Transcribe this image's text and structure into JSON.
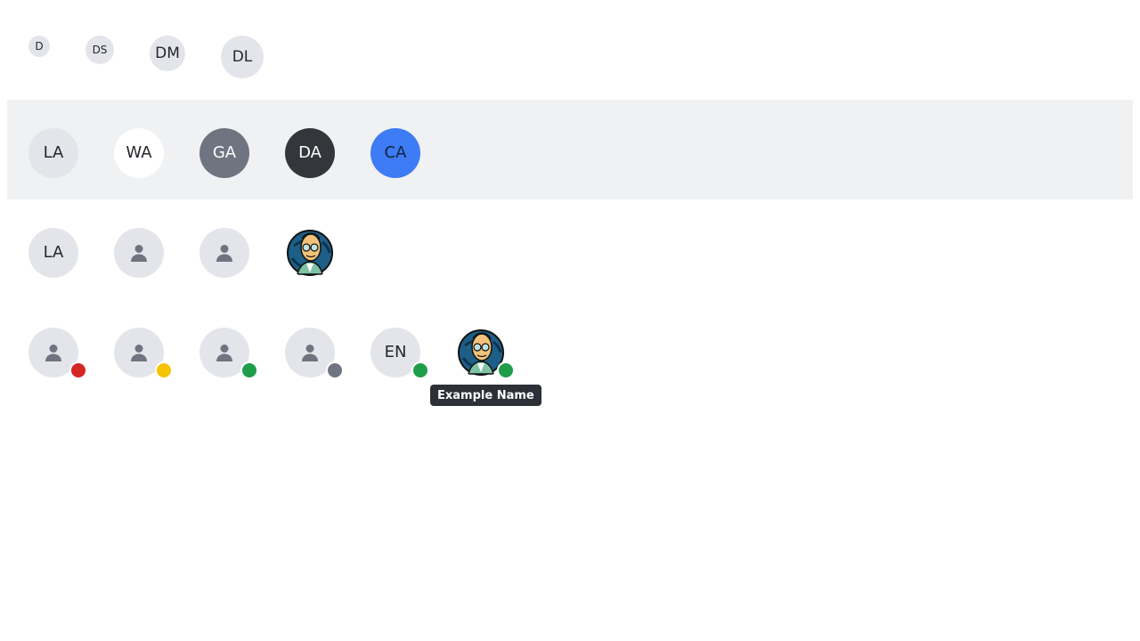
{
  "sizes_row": {
    "avatars": [
      {
        "initials": "D"
      },
      {
        "initials": "DS"
      },
      {
        "initials": "DM"
      },
      {
        "initials": "DL"
      }
    ]
  },
  "colors_row": {
    "avatars": [
      {
        "initials": "LA",
        "variant": "light",
        "bg": "#e4e5ea",
        "fg": "#24272c"
      },
      {
        "initials": "WA",
        "variant": "white",
        "bg": "#ffffff",
        "fg": "#24272c"
      },
      {
        "initials": "GA",
        "variant": "gray",
        "bg": "#6f7480",
        "fg": "#ffffff"
      },
      {
        "initials": "DA",
        "variant": "dark",
        "bg": "#33363b",
        "fg": "#ffffff"
      },
      {
        "initials": "CA",
        "variant": "color",
        "bg": "#3e7cf6",
        "fg": "#12233f"
      }
    ]
  },
  "types_row": {
    "avatars": [
      {
        "type": "initials",
        "initials": "LA"
      },
      {
        "type": "icon",
        "icon": "person-icon"
      },
      {
        "type": "icon",
        "icon": "person-icon"
      },
      {
        "type": "image",
        "icon": "profile-photo"
      }
    ]
  },
  "status_row": {
    "avatars": [
      {
        "type": "icon",
        "icon": "person-icon",
        "status": "busy",
        "status_color": "#d42424"
      },
      {
        "type": "icon",
        "icon": "person-icon",
        "status": "away",
        "status_color": "#f5c400"
      },
      {
        "type": "icon",
        "icon": "person-icon",
        "status": "online",
        "status_color": "#1f9d4b"
      },
      {
        "type": "icon",
        "icon": "person-icon",
        "status": "offline",
        "status_color": "#6f7480"
      },
      {
        "type": "initials",
        "initials": "EN",
        "status": "online",
        "status_color": "#1f9d4b"
      },
      {
        "type": "image",
        "icon": "profile-photo",
        "status": "online",
        "status_color": "#1f9d4b"
      }
    ],
    "tooltip": "Example Name"
  }
}
